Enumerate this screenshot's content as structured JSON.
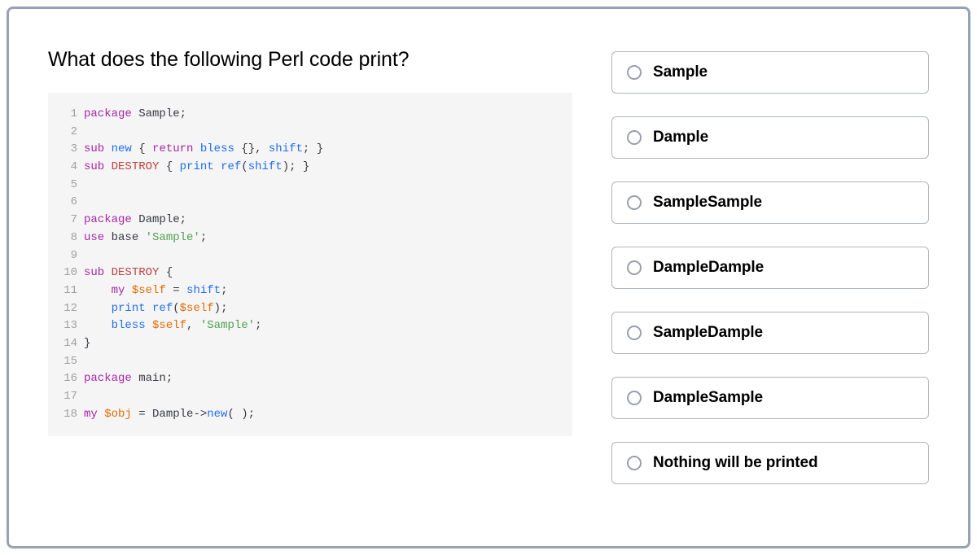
{
  "question": {
    "title": "What does the following Perl code print?"
  },
  "code": {
    "lines": [
      [
        {
          "t": "package ",
          "c": "tok-kw"
        },
        {
          "t": "Sample;",
          "c": "tok-plain"
        }
      ],
      [],
      [
        {
          "t": "sub ",
          "c": "tok-kw"
        },
        {
          "t": "new",
          "c": "tok-func"
        },
        {
          "t": " { ",
          "c": "tok-punc"
        },
        {
          "t": "return",
          "c": "tok-kw"
        },
        {
          "t": " ",
          "c": "tok-plain"
        },
        {
          "t": "bless",
          "c": "tok-func"
        },
        {
          "t": " {}, ",
          "c": "tok-punc"
        },
        {
          "t": "shift",
          "c": "tok-func"
        },
        {
          "t": "; }",
          "c": "tok-punc"
        }
      ],
      [
        {
          "t": "sub ",
          "c": "tok-kw"
        },
        {
          "t": "DESTROY",
          "c": "tok-sub"
        },
        {
          "t": " { ",
          "c": "tok-punc"
        },
        {
          "t": "print",
          "c": "tok-func"
        },
        {
          "t": " ",
          "c": "tok-plain"
        },
        {
          "t": "ref",
          "c": "tok-func"
        },
        {
          "t": "(",
          "c": "tok-punc"
        },
        {
          "t": "shift",
          "c": "tok-func"
        },
        {
          "t": "); }",
          "c": "tok-punc"
        }
      ],
      [],
      [],
      [
        {
          "t": "package ",
          "c": "tok-kw"
        },
        {
          "t": "Dample;",
          "c": "tok-plain"
        }
      ],
      [
        {
          "t": "use ",
          "c": "tok-kw"
        },
        {
          "t": "base ",
          "c": "tok-plain"
        },
        {
          "t": "'Sample'",
          "c": "tok-str"
        },
        {
          "t": ";",
          "c": "tok-punc"
        }
      ],
      [],
      [
        {
          "t": "sub ",
          "c": "tok-kw"
        },
        {
          "t": "DESTROY",
          "c": "tok-sub"
        },
        {
          "t": " {",
          "c": "tok-punc"
        }
      ],
      [
        {
          "t": "    ",
          "c": "tok-plain"
        },
        {
          "t": "my",
          "c": "tok-kw"
        },
        {
          "t": " ",
          "c": "tok-plain"
        },
        {
          "t": "$self",
          "c": "tok-var"
        },
        {
          "t": " = ",
          "c": "tok-punc"
        },
        {
          "t": "shift",
          "c": "tok-func"
        },
        {
          "t": ";",
          "c": "tok-punc"
        }
      ],
      [
        {
          "t": "    ",
          "c": "tok-plain"
        },
        {
          "t": "print",
          "c": "tok-func"
        },
        {
          "t": " ",
          "c": "tok-plain"
        },
        {
          "t": "ref",
          "c": "tok-func"
        },
        {
          "t": "(",
          "c": "tok-punc"
        },
        {
          "t": "$self",
          "c": "tok-var"
        },
        {
          "t": ");",
          "c": "tok-punc"
        }
      ],
      [
        {
          "t": "    ",
          "c": "tok-plain"
        },
        {
          "t": "bless",
          "c": "tok-func"
        },
        {
          "t": " ",
          "c": "tok-plain"
        },
        {
          "t": "$self",
          "c": "tok-var"
        },
        {
          "t": ", ",
          "c": "tok-punc"
        },
        {
          "t": "'Sample'",
          "c": "tok-str"
        },
        {
          "t": ";",
          "c": "tok-punc"
        }
      ],
      [
        {
          "t": "}",
          "c": "tok-punc"
        }
      ],
      [],
      [
        {
          "t": "package ",
          "c": "tok-kw"
        },
        {
          "t": "main;",
          "c": "tok-plain"
        }
      ],
      [],
      [
        {
          "t": "my",
          "c": "tok-kw"
        },
        {
          "t": " ",
          "c": "tok-plain"
        },
        {
          "t": "$obj",
          "c": "tok-var"
        },
        {
          "t": " = Dample->",
          "c": "tok-punc"
        },
        {
          "t": "new",
          "c": "tok-func"
        },
        {
          "t": "( );",
          "c": "tok-punc"
        }
      ]
    ]
  },
  "answers": {
    "options": [
      {
        "label": "Sample"
      },
      {
        "label": "Dample"
      },
      {
        "label": "SampleSample"
      },
      {
        "label": "DampleDample"
      },
      {
        "label": "SampleDample"
      },
      {
        "label": "DampleSample"
      },
      {
        "label": "Nothing will be printed"
      }
    ]
  }
}
